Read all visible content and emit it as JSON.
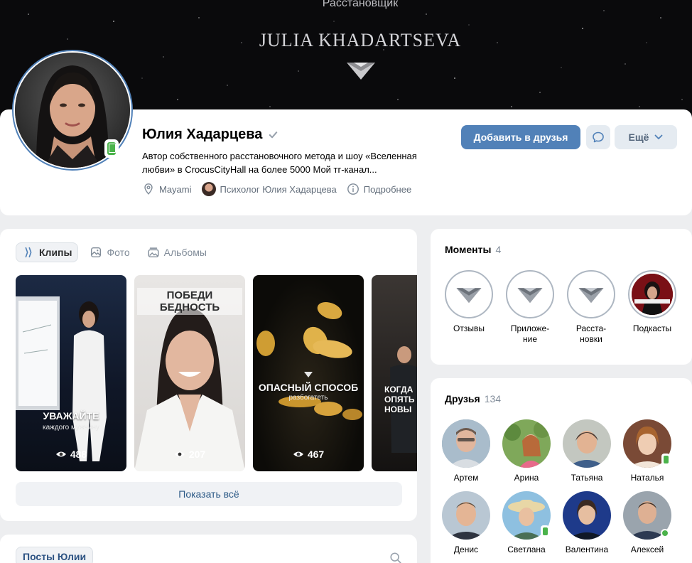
{
  "cover": {
    "subtitle": "Расстановщик",
    "title": "JULIA KHADARTSEVA"
  },
  "profile": {
    "name": "Юлия Хадарцева",
    "bio": "Автор собственного расстановочного метода и шоу «Вселенная любви» в CrocusCityHall на более 5000 Мой тг-канал...",
    "location": "Mayami",
    "community": "Психолог Юлия Хадарцева",
    "details": "Подробнее",
    "add_friend": "Добавить в друзья",
    "more": "Ещё"
  },
  "media": {
    "tabs": [
      {
        "label": "Клипы",
        "icon": "clips-icon",
        "active": true
      },
      {
        "label": "Фото",
        "icon": "photo-icon",
        "active": false
      },
      {
        "label": "Альбомы",
        "icon": "albums-icon",
        "active": false
      }
    ],
    "clips": [
      {
        "caption": "УВАЖАЙТЕ",
        "sub": "каждого мужчину",
        "views": "488"
      },
      {
        "banner": "ПОБЕДИ БЕДНОСТЬ",
        "views": "207"
      },
      {
        "caption": "ОПАСНЫЙ СПОСОБ",
        "sub": "разбогатеть",
        "views": "467"
      },
      {
        "caption": "КОГДА ОПЯТЬ В НОВЫ",
        "views": ""
      }
    ],
    "show_all": "Показать всё"
  },
  "posts": {
    "tab": "Посты Юлии"
  },
  "moments": {
    "title": "Моменты",
    "count": "4",
    "items": [
      {
        "label": "Отзывы"
      },
      {
        "label": "Приложе-ние"
      },
      {
        "label": "Расста-новки"
      },
      {
        "label": "Подкасты"
      }
    ]
  },
  "friends": {
    "title": "Друзья",
    "count": "134",
    "items": [
      {
        "name": "Артем"
      },
      {
        "name": "Арина"
      },
      {
        "name": "Татьяна"
      },
      {
        "name": "Наталья"
      },
      {
        "name": "Денис"
      },
      {
        "name": "Светлана"
      },
      {
        "name": "Валентина"
      },
      {
        "name": "Алексей"
      }
    ]
  },
  "colors": {
    "accent": "#5181b8",
    "page_bg": "#edeef0",
    "online": "#4bb34b"
  }
}
